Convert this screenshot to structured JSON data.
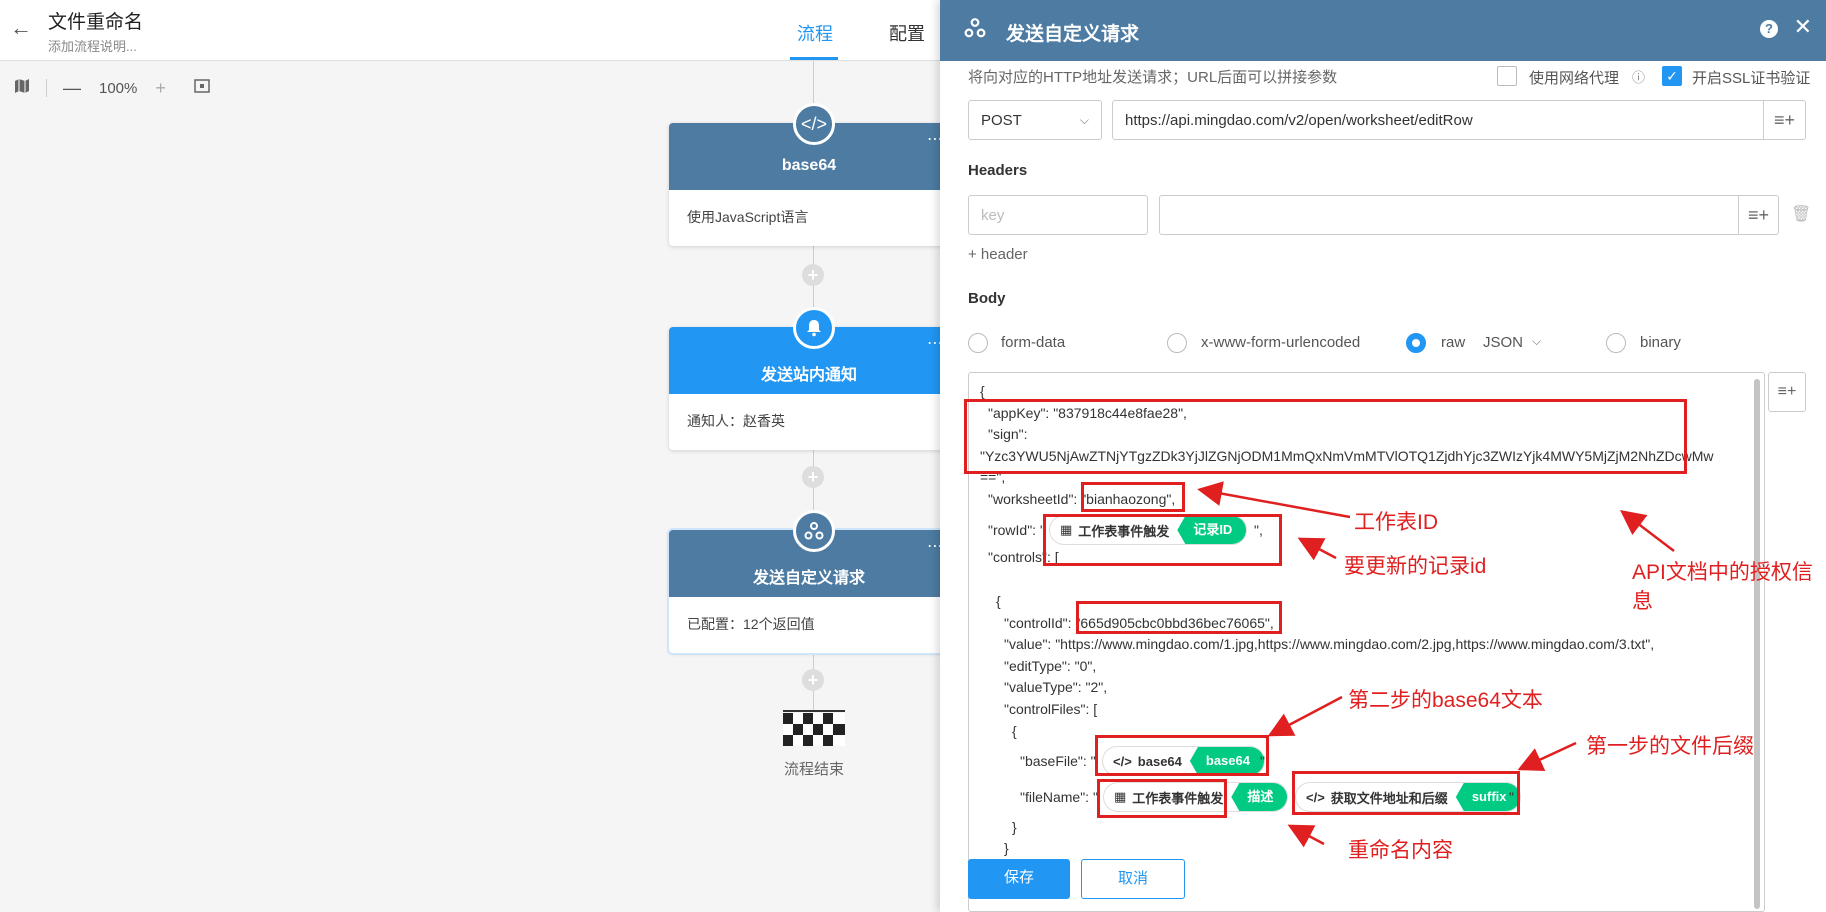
{
  "header": {
    "title": "文件重命名",
    "subtitle": "添加流程说明...",
    "tabs": [
      {
        "label": "流程"
      },
      {
        "label": "配置"
      }
    ]
  },
  "toolbar": {
    "zoom": "100%"
  },
  "flow": {
    "nodes": [
      {
        "title": "base64",
        "body": "使用JavaScript语言",
        "color": "#4d7ba2"
      },
      {
        "title": "发送站内通知",
        "body": "通知人：赵香英",
        "color": "#2196f3"
      },
      {
        "title": "发送自定义请求",
        "body": "已配置：12个返回值",
        "color": "#4d7ba2"
      }
    ],
    "end_label": "流程结束"
  },
  "panel": {
    "title": "发送自定义请求",
    "description": "将向对应的HTTP地址发送请求；URL后面可以拼接参数",
    "proxy_label": "使用网络代理",
    "ssl_label": "开启SSL证书验证",
    "method": "POST",
    "url": "https://api.mingdao.com/v2/open/worksheet/editRow",
    "headers_title": "Headers",
    "key_placeholder": "key",
    "add_header": "+ header",
    "body_title": "Body",
    "body_options": {
      "form_data": "form-data",
      "urlencoded": "x-www-form-urlencoded",
      "raw": "raw",
      "raw_type": "JSON",
      "binary": "binary"
    },
    "code": {
      "l_open": "{",
      "appkey": "\"appKey\": \"837918c44e8fae28\",",
      "sign_key": "\"sign\":",
      "sign_val": "\"Yzc3YWU5NjAwZTNjYTgzZDk3YjJlZGNjODM1MmQxNmVmMTVlOTQ1ZjdhYjc3ZWIzYjk4MWY5MjZjM2NhZDcwMw",
      "sign_end": "==\",",
      "worksheet": "\"worksheetId\": \"bianhaozong\",",
      "rowid_key": "\"rowId\": \"",
      "rowid_end": "\",",
      "controls": "\"controls\": [",
      "brace_open": "{",
      "controlid": "\"controlId\": \"665d905cbc0bbd36bec76065\",",
      "value": "\"value\": \"https://www.mingdao.com/1.jpg,https://www.mingdao.com/2.jpg,https://www.mingdao.com/3.txt\",",
      "edittype": "\"editType\": \"0\",",
      "valuetype": "\"valueType\": \"2\",",
      "controlfiles": "\"controlFiles\": [",
      "brace_open2": "{",
      "basefile_key": "\"baseFile\": \"",
      "quote_end": "\"",
      "filename_key": "\"fileName\": \"",
      "quote_end2": "\"",
      "brace_close": "}",
      "brace_close2": "}"
    },
    "tags": {
      "rowid": {
        "src": "工作表事件触发",
        "field": "记录ID"
      },
      "basefile": {
        "src": "base64",
        "field": "base64"
      },
      "filename1": {
        "src": "工作表事件触发",
        "field": "描述"
      },
      "filename2": {
        "src": "获取文件地址和后缀",
        "field": "suffix"
      }
    },
    "save": "保存",
    "cancel": "取消"
  },
  "annotations": {
    "worksheet_id": "工作表ID",
    "row_id": "要更新的记录id",
    "auth_line1": "API文档中的授权信",
    "auth_line2": "息",
    "base64_text": "第二步的base64文本",
    "suffix": "第一步的文件后缀",
    "rename": "重命名内容"
  },
  "colors": {
    "accent": "#2196f3",
    "panel_header": "#4d7ba2",
    "tag_green": "#01ca83",
    "annotation_red": "#e02020"
  }
}
